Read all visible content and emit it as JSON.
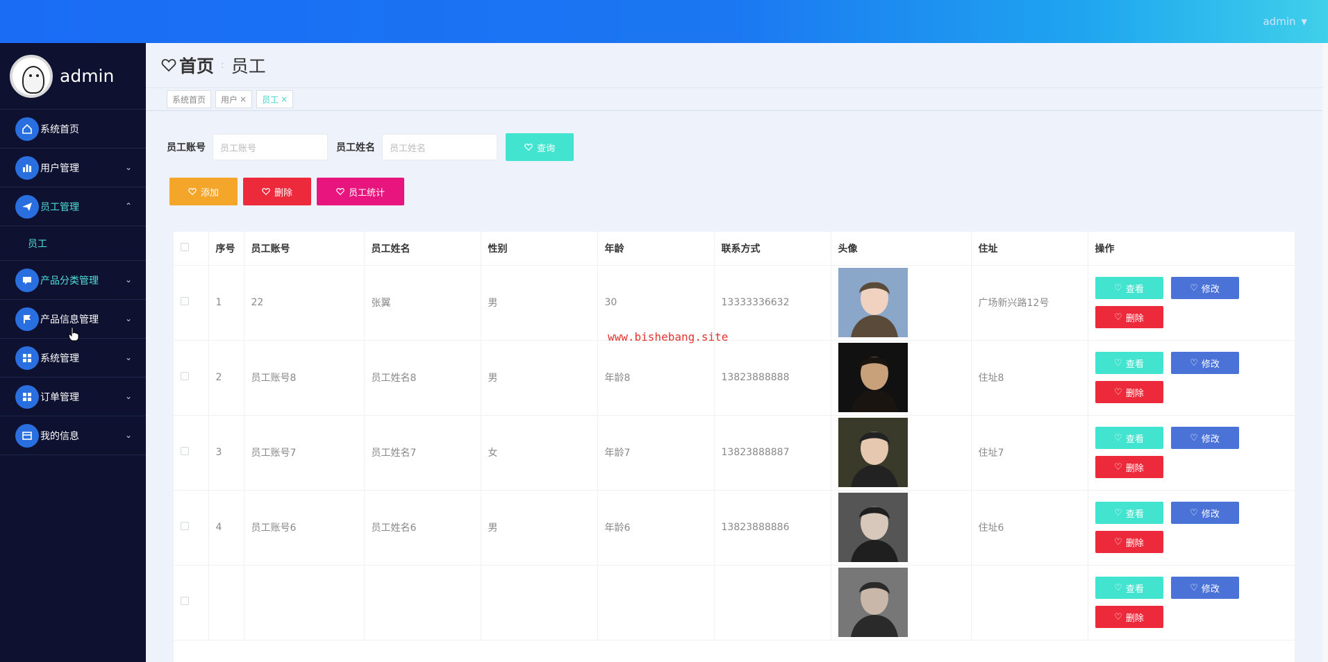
{
  "topbar": {
    "user": "admin"
  },
  "sidebar": {
    "profile_name": "admin",
    "items": [
      {
        "label": "系统首页",
        "icon": "home-icon"
      },
      {
        "label": "用户管理",
        "icon": "chart-icon",
        "expandable": true
      },
      {
        "label": "员工管理",
        "icon": "send-icon",
        "expandable": true,
        "expanded": true
      },
      {
        "label": "产品分类管理",
        "icon": "chat-icon",
        "expandable": true,
        "active": true
      },
      {
        "label": "产品信息管理",
        "icon": "flag-icon",
        "expandable": true
      },
      {
        "label": "系统管理",
        "icon": "grid-icon",
        "expandable": true
      },
      {
        "label": "订单管理",
        "icon": "grid-icon",
        "expandable": true
      },
      {
        "label": "我的信息",
        "icon": "card-icon",
        "expandable": true
      }
    ],
    "subitem": "员工"
  },
  "header": {
    "home": "首页",
    "current": "员工"
  },
  "tags": [
    {
      "label": "系统首页",
      "closable": false
    },
    {
      "label": "用户",
      "closable": true
    },
    {
      "label": "员工",
      "closable": true,
      "active": true
    }
  ],
  "search": {
    "account_label": "员工账号",
    "account_placeholder": "员工账号",
    "name_label": "员工姓名",
    "name_placeholder": "员工姓名",
    "query_label": "查询"
  },
  "actions": {
    "add": "添加",
    "delete": "删除",
    "stats": "员工统计"
  },
  "table": {
    "headers": [
      "序号",
      "员工账号",
      "员工姓名",
      "性别",
      "年龄",
      "联系方式",
      "头像",
      "住址",
      "操作"
    ],
    "rows": [
      {
        "index": "1",
        "account": "22",
        "name": "张翼",
        "gender": "男",
        "age": "30",
        "phone": "13333336632",
        "address": "广场新兴路12号"
      },
      {
        "index": "2",
        "account": "员工账号8",
        "name": "员工姓名8",
        "gender": "男",
        "age": "年龄8",
        "phone": "13823888888",
        "address": "住址8"
      },
      {
        "index": "3",
        "account": "员工账号7",
        "name": "员工姓名7",
        "gender": "女",
        "age": "年龄7",
        "phone": "13823888887",
        "address": "住址7"
      },
      {
        "index": "4",
        "account": "员工账号6",
        "name": "员工姓名6",
        "gender": "男",
        "age": "年龄6",
        "phone": "13823888886",
        "address": "住址6"
      },
      {
        "index": "",
        "account": "",
        "name": "",
        "gender": "",
        "age": "",
        "phone": "",
        "address": ""
      }
    ],
    "op_view": "查看",
    "op_edit": "修改",
    "op_delete": "删除"
  },
  "watermark": "www.bishebang.site",
  "colors": {
    "topbar": "#1a6cf5",
    "sidebar": "#0e1130",
    "accent": "#42e3cf",
    "danger": "#ed2a3b",
    "edit": "#4a72d7",
    "warning": "#f4a62a",
    "pink": "#e8157f"
  }
}
